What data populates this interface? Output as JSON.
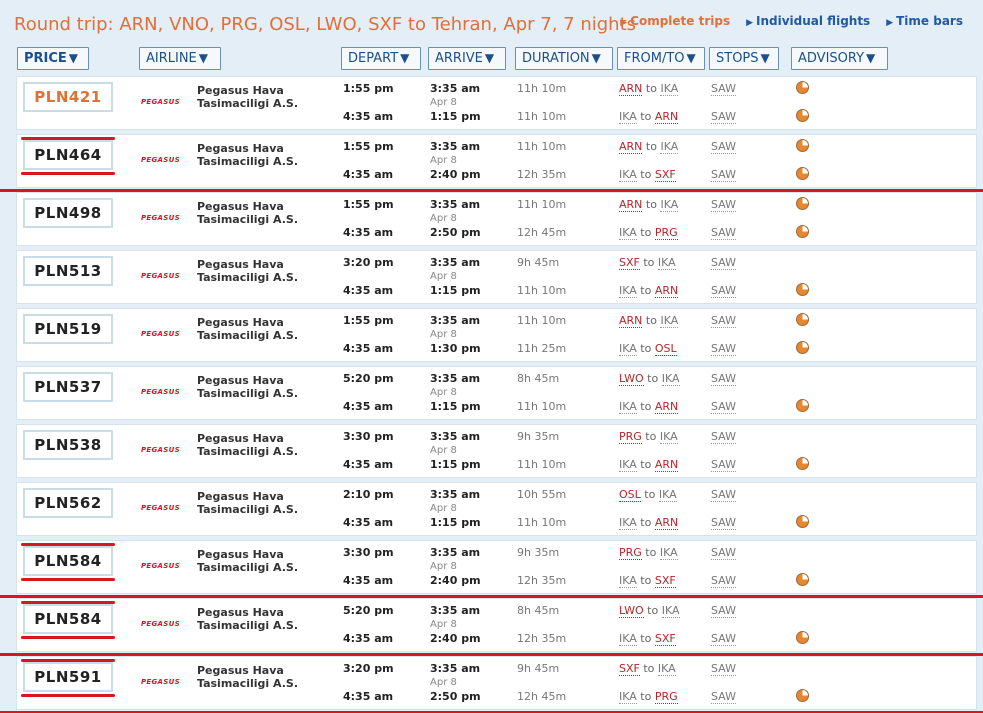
{
  "header": {
    "title": "Round trip: ARN, VNO, PRG, OSL, LWO, SXF to Tehran, Apr 7, 7 nights",
    "view_links": [
      {
        "label": "Complete trips",
        "active": true
      },
      {
        "label": "Individual flights",
        "active": false
      },
      {
        "label": "Time bars",
        "active": false
      }
    ]
  },
  "columns": [
    {
      "label": "PRICE",
      "name": "price"
    },
    {
      "label": "AIRLINE",
      "name": "airline"
    },
    {
      "label": "DEPART",
      "name": "depart"
    },
    {
      "label": "ARRIVE",
      "name": "arrive"
    },
    {
      "label": "DURATION",
      "name": "duration"
    },
    {
      "label": "FROM/TO",
      "name": "from-to"
    },
    {
      "label": "STOPS",
      "name": "stops"
    },
    {
      "label": "ADVISORY",
      "name": "advisory"
    }
  ],
  "airline": {
    "logo": "PEGASUS",
    "name_line1": "Pegasus Hava",
    "name_line2": "Tasimaciligi A.S."
  },
  "results": [
    {
      "price": "PLN421",
      "highlighted": false,
      "outbound": {
        "depart": "1:55 pm",
        "arrive": "3:35 am",
        "arrive_date": "Apr 8",
        "duration": "11h 10m",
        "from": "ARN",
        "to": "IKA",
        "stops": "SAW",
        "advisory": true
      },
      "return": {
        "depart": "4:35 am",
        "arrive": "1:15 pm",
        "duration": "11h 10m",
        "from": "IKA",
        "to": "ARN",
        "stops": "SAW",
        "advisory": true
      }
    },
    {
      "price": "PLN464",
      "highlighted": true,
      "outbound": {
        "depart": "1:55 pm",
        "arrive": "3:35 am",
        "arrive_date": "Apr 8",
        "duration": "11h 10m",
        "from": "ARN",
        "to": "IKA",
        "stops": "SAW",
        "advisory": true
      },
      "return": {
        "depart": "4:35 am",
        "arrive": "2:40 pm",
        "duration": "12h 35m",
        "from": "IKA",
        "to": "SXF",
        "stops": "SAW",
        "advisory": true
      }
    },
    {
      "price": "PLN498",
      "highlighted": false,
      "outbound": {
        "depart": "1:55 pm",
        "arrive": "3:35 am",
        "arrive_date": "Apr 8",
        "duration": "11h 10m",
        "from": "ARN",
        "to": "IKA",
        "stops": "SAW",
        "advisory": true
      },
      "return": {
        "depart": "4:35 am",
        "arrive": "2:50 pm",
        "duration": "12h 45m",
        "from": "IKA",
        "to": "PRG",
        "stops": "SAW",
        "advisory": true
      }
    },
    {
      "price": "PLN513",
      "highlighted": false,
      "outbound": {
        "depart": "3:20 pm",
        "arrive": "3:35 am",
        "arrive_date": "Apr 8",
        "duration": "9h 45m",
        "from": "SXF",
        "to": "IKA",
        "stops": "SAW",
        "advisory": false
      },
      "return": {
        "depart": "4:35 am",
        "arrive": "1:15 pm",
        "duration": "11h 10m",
        "from": "IKA",
        "to": "ARN",
        "stops": "SAW",
        "advisory": true
      }
    },
    {
      "price": "PLN519",
      "highlighted": false,
      "outbound": {
        "depart": "1:55 pm",
        "arrive": "3:35 am",
        "arrive_date": "Apr 8",
        "duration": "11h 10m",
        "from": "ARN",
        "to": "IKA",
        "stops": "SAW",
        "advisory": true
      },
      "return": {
        "depart": "4:35 am",
        "arrive": "1:30 pm",
        "duration": "11h 25m",
        "from": "IKA",
        "to": "OSL",
        "stops": "SAW",
        "advisory": true
      }
    },
    {
      "price": "PLN537",
      "highlighted": false,
      "outbound": {
        "depart": "5:20 pm",
        "arrive": "3:35 am",
        "arrive_date": "Apr 8",
        "duration": "8h 45m",
        "from": "LWO",
        "to": "IKA",
        "stops": "SAW",
        "advisory": false
      },
      "return": {
        "depart": "4:35 am",
        "arrive": "1:15 pm",
        "duration": "11h 10m",
        "from": "IKA",
        "to": "ARN",
        "stops": "SAW",
        "advisory": true
      }
    },
    {
      "price": "PLN538",
      "highlighted": false,
      "outbound": {
        "depart": "3:30 pm",
        "arrive": "3:35 am",
        "arrive_date": "Apr 8",
        "duration": "9h 35m",
        "from": "PRG",
        "to": "IKA",
        "stops": "SAW",
        "advisory": false
      },
      "return": {
        "depart": "4:35 am",
        "arrive": "1:15 pm",
        "duration": "11h 10m",
        "from": "IKA",
        "to": "ARN",
        "stops": "SAW",
        "advisory": true
      }
    },
    {
      "price": "PLN562",
      "highlighted": false,
      "outbound": {
        "depart": "2:10 pm",
        "arrive": "3:35 am",
        "arrive_date": "Apr 8",
        "duration": "10h 55m",
        "from": "OSL",
        "to": "IKA",
        "stops": "SAW",
        "advisory": false
      },
      "return": {
        "depart": "4:35 am",
        "arrive": "1:15 pm",
        "duration": "11h 10m",
        "from": "IKA",
        "to": "ARN",
        "stops": "SAW",
        "advisory": true
      }
    },
    {
      "price": "PLN584",
      "highlighted": true,
      "outbound": {
        "depart": "3:30 pm",
        "arrive": "3:35 am",
        "arrive_date": "Apr 8",
        "duration": "9h 35m",
        "from": "PRG",
        "to": "IKA",
        "stops": "SAW",
        "advisory": false
      },
      "return": {
        "depart": "4:35 am",
        "arrive": "2:40 pm",
        "duration": "12h 35m",
        "from": "IKA",
        "to": "SXF",
        "stops": "SAW",
        "advisory": true
      }
    },
    {
      "price": "PLN584",
      "highlighted": true,
      "outbound": {
        "depart": "5:20 pm",
        "arrive": "3:35 am",
        "arrive_date": "Apr 8",
        "duration": "8h 45m",
        "from": "LWO",
        "to": "IKA",
        "stops": "SAW",
        "advisory": false
      },
      "return": {
        "depart": "4:35 am",
        "arrive": "2:40 pm",
        "duration": "12h 35m",
        "from": "IKA",
        "to": "SXF",
        "stops": "SAW",
        "advisory": true
      }
    },
    {
      "price": "PLN591",
      "highlighted": true,
      "outbound": {
        "depart": "3:20 pm",
        "arrive": "3:35 am",
        "arrive_date": "Apr 8",
        "duration": "9h 45m",
        "from": "SXF",
        "to": "IKA",
        "stops": "SAW",
        "advisory": false
      },
      "return": {
        "depart": "4:35 am",
        "arrive": "2:50 pm",
        "duration": "12h 45m",
        "from": "IKA",
        "to": "PRG",
        "stops": "SAW",
        "advisory": true
      }
    }
  ],
  "colors": {
    "accent": "#e0703a",
    "link": "#1f5aa6",
    "highlight_red": "#d9151f"
  }
}
